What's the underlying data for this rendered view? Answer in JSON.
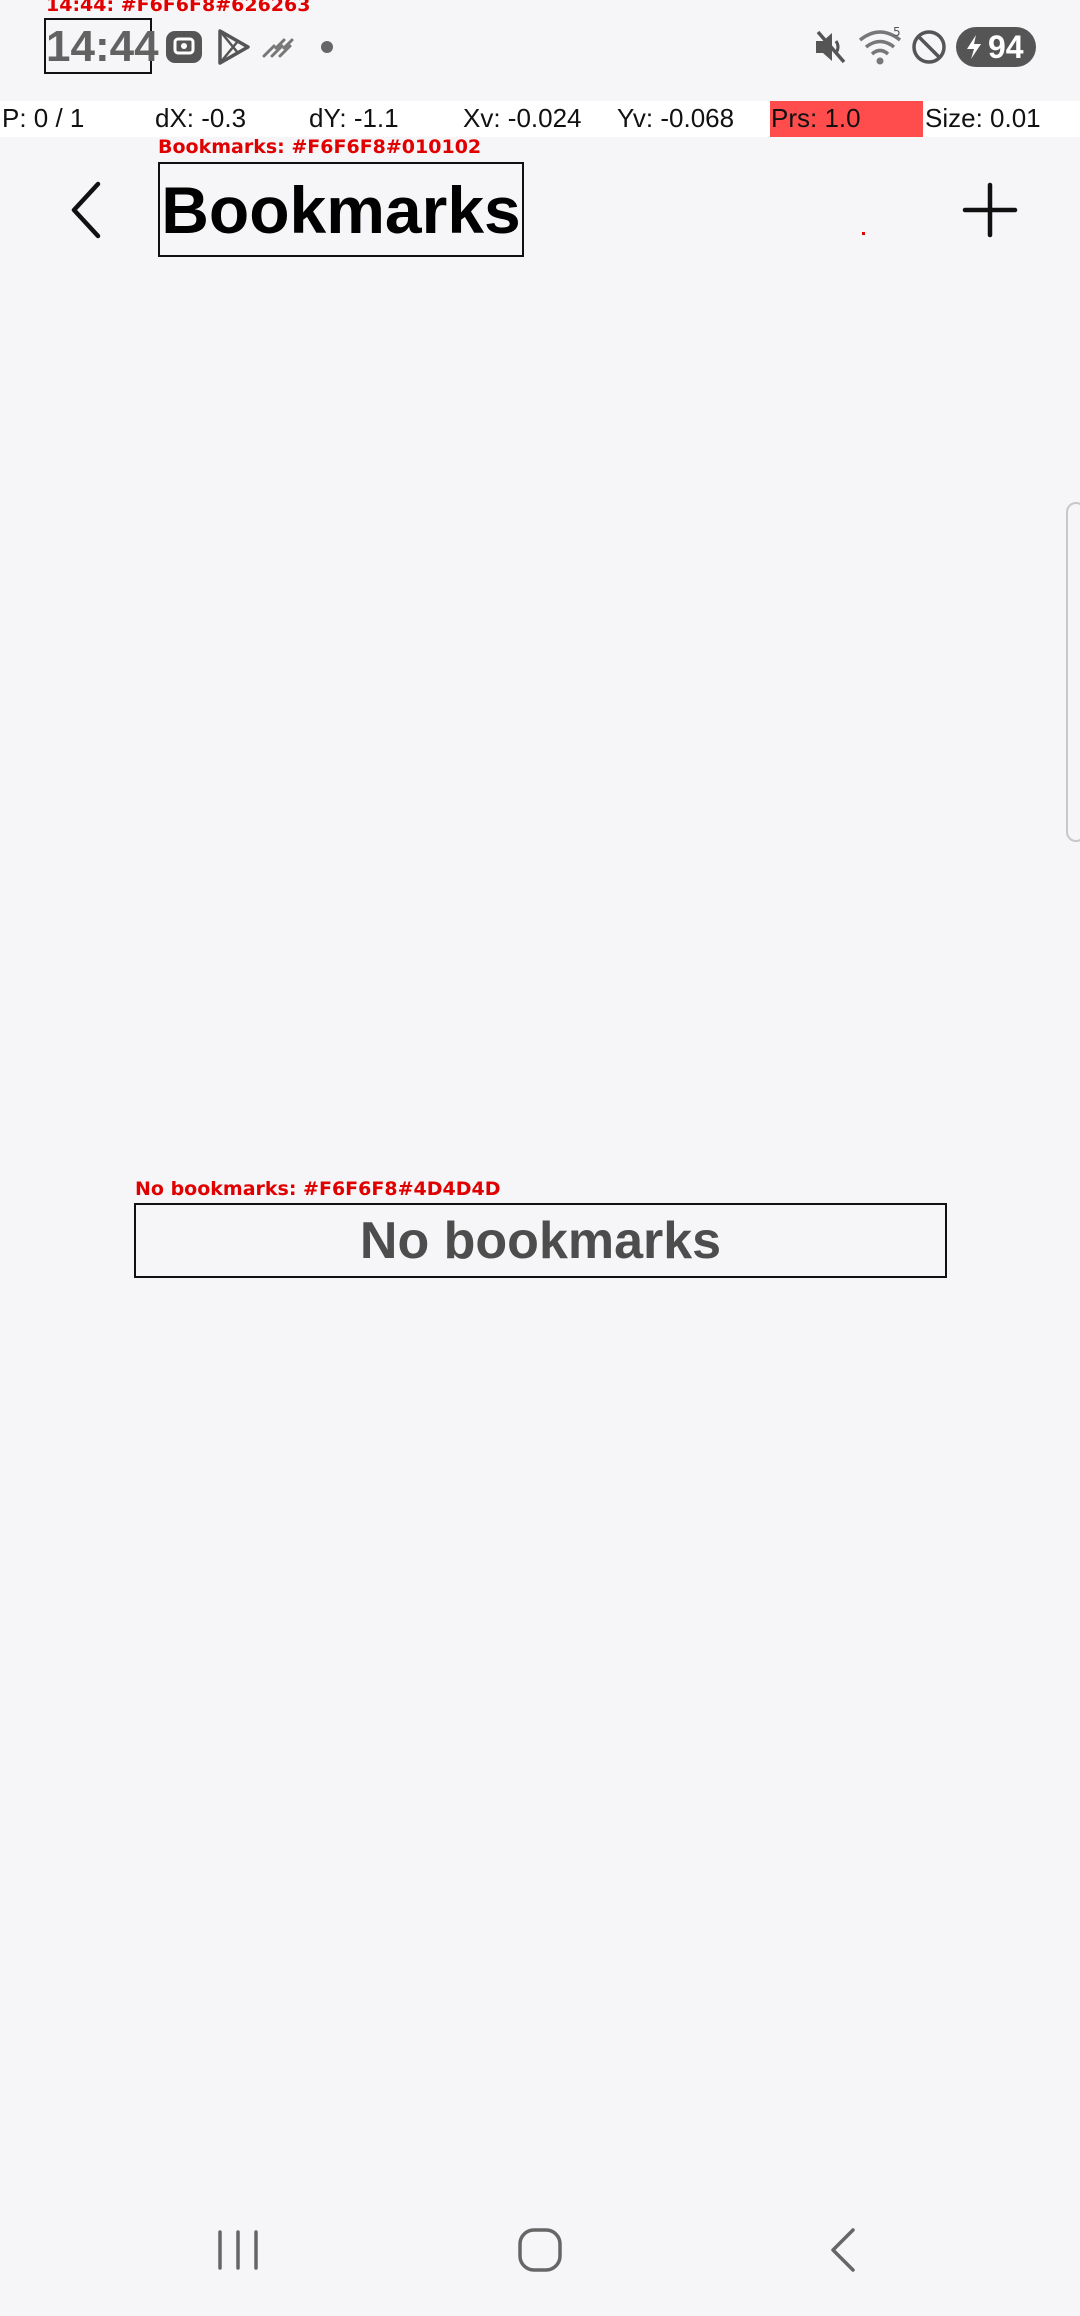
{
  "status_bar": {
    "time": "14:44",
    "time_annotation": "14:44: #F6F6F8#626263",
    "battery": "94",
    "icons": [
      "photo-notification-icon",
      "play-store-icon",
      "haze-icon",
      "dot-icon",
      "mute-icon",
      "wifi-icon",
      "do-not-disturb-icon",
      "battery-icon"
    ]
  },
  "pointer_bar": {
    "p": "P: 0 / 1",
    "dx": "dX: -0.3",
    "dy": "dY: -1.1",
    "xv": "Xv: -0.024",
    "yv": "Yv: -0.068",
    "prs": "Prs: 1.0",
    "size": "Size: 0.01"
  },
  "app_bar": {
    "title": "Bookmarks",
    "title_annotation": "Bookmarks: #F6F6F8#010102",
    "back_icon": "back-chevron-icon",
    "add_icon": "plus-icon"
  },
  "empty_state": {
    "message": "No bookmarks",
    "annotation": "No bookmarks: #F6F6F8#4D4D4D"
  },
  "nav_bar": {
    "icons": [
      "recents-icon",
      "home-icon",
      "back-icon"
    ]
  },
  "colors": {
    "background": "#F6F6F8",
    "title_text": "#010102",
    "empty_text": "#4D4D4D",
    "time_text": "#626263",
    "annotation": "#E00000",
    "pressure_highlight": "#FF4D4D"
  }
}
